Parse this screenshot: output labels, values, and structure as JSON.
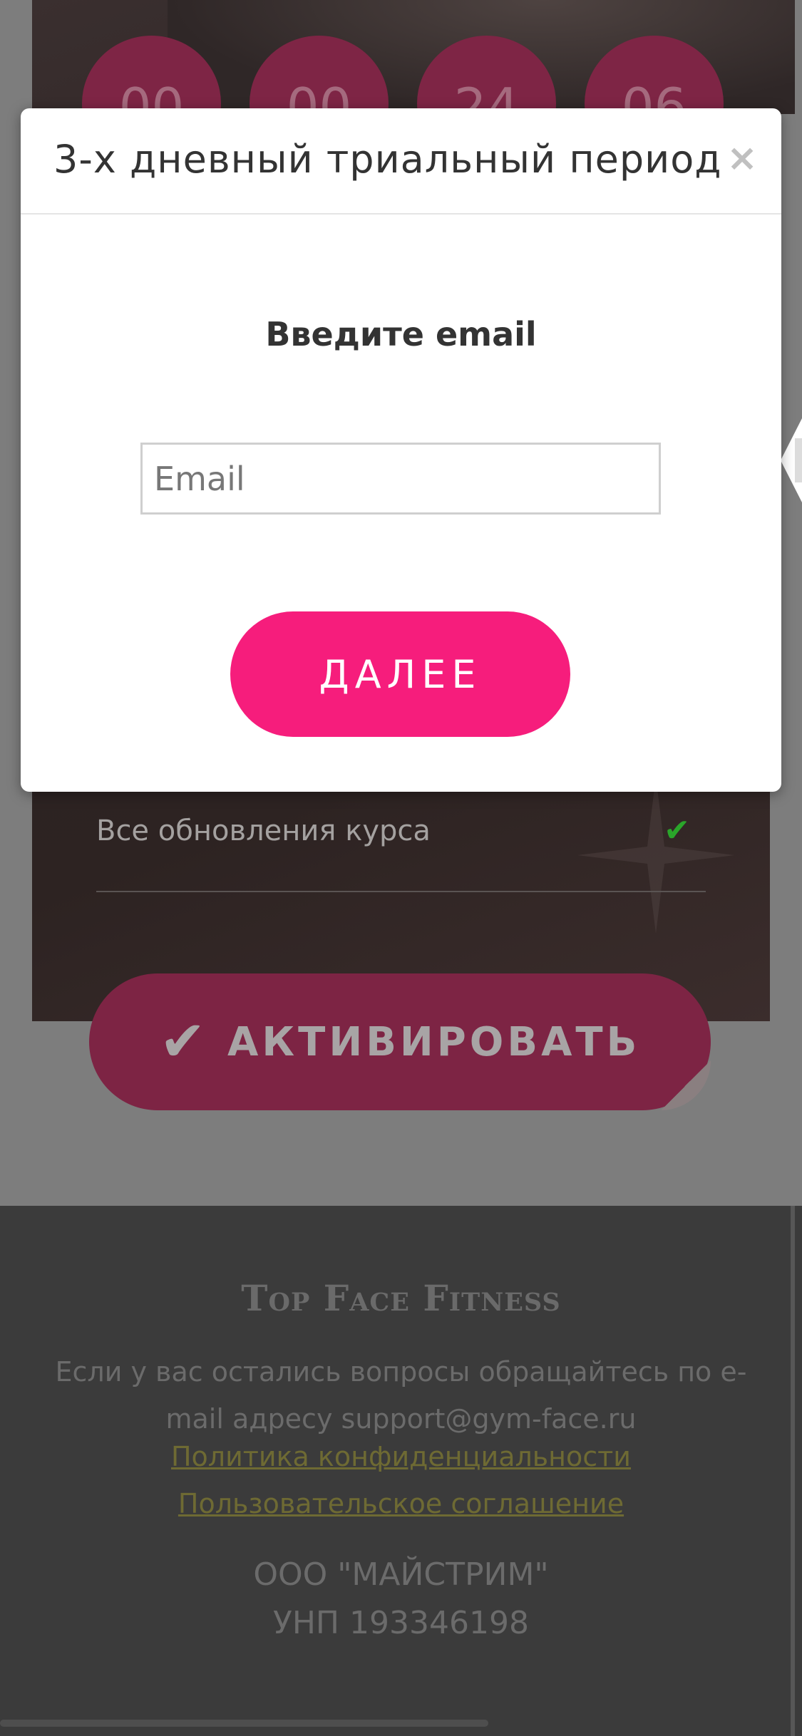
{
  "timer": {
    "digits": [
      "00",
      "00",
      "24",
      "06"
    ]
  },
  "background": {
    "feature_label": "Все обновления курса",
    "activate_label": "АКТИВИРОВАТЬ"
  },
  "footer": {
    "brand": "Top Face Fitness",
    "contact_text": "Если у вас остались вопросы обращайтесь по e-mail адресу support@gym-face.ru",
    "privacy_link": "Политика конфиденциальности",
    "terms_link": "Пользовательское соглашение",
    "company_name": "ООО \"МАЙСТРИМ\"",
    "company_unp": "УНП 193346198"
  },
  "modal": {
    "title": "3-х дневный триальный период",
    "close_glyph": "×",
    "heading": "Введите email",
    "email_placeholder": "Email",
    "email_value": "",
    "next_label": "ДАЛЕЕ"
  },
  "colors": {
    "accent": "#f61d7c",
    "check": "#2aa52a",
    "footer_link": "#6e6a33"
  }
}
